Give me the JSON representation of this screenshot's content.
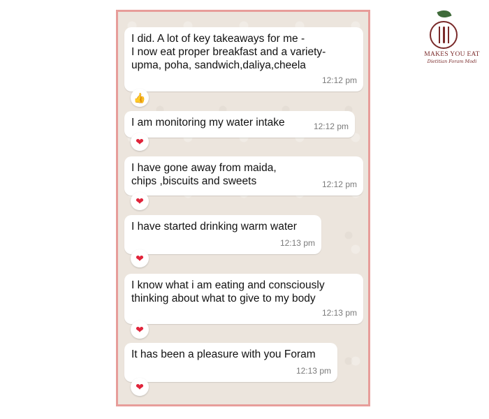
{
  "brand": {
    "name": "MAKES YOU EAT",
    "tagline": "Dietitian Foram Modi"
  },
  "messages": [
    {
      "text": "I did. A lot of key takeaways for me -\nI now eat proper breakfast and a variety-\nupma, poha, sandwich,daliya,cheela",
      "time": "12:12 pm",
      "reaction": "👍"
    },
    {
      "text": "I am monitoring my water intake",
      "time": "12:12 pm",
      "reaction": "❤"
    },
    {
      "text": "I have gone away from maida,\nchips ,biscuits and sweets",
      "time": "12:12 pm",
      "reaction": "❤"
    },
    {
      "text": "I have started drinking warm water",
      "time": "12:13 pm",
      "reaction": "❤"
    },
    {
      "text": "I know what i am eating and consciously\nthinking about what to give to my body",
      "time": "12:13 pm",
      "reaction": "❤"
    },
    {
      "text": "It has been a pleasure with you Foram",
      "time": "12:13 pm",
      "reaction": "❤"
    }
  ]
}
